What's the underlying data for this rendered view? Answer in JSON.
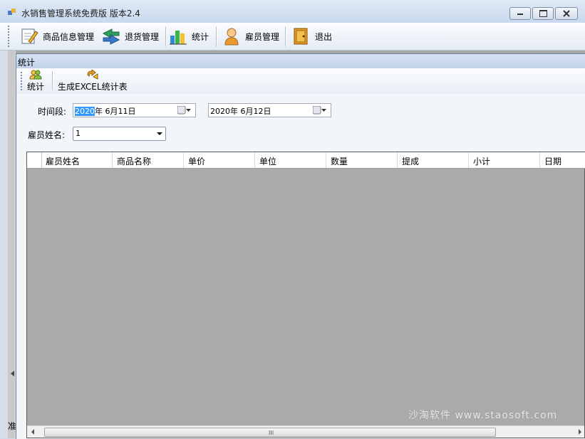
{
  "window": {
    "title": "水销售管理系统免费版 版本2.4"
  },
  "main_toolbar": {
    "items": [
      {
        "label": "商品信息管理",
        "icon": "edit-document-icon"
      },
      {
        "label": "退货管理",
        "icon": "return-arrows-icon"
      },
      {
        "label": "统计",
        "icon": "bar-chart-icon"
      },
      {
        "label": "雇员管理",
        "icon": "employee-icon"
      },
      {
        "label": "退出",
        "icon": "exit-door-icon"
      }
    ]
  },
  "status_bar": {
    "text_fragment": "准"
  },
  "child_window": {
    "title": "统计",
    "toolbar": {
      "items": [
        {
          "label": "统计",
          "icon": "users-icon"
        },
        {
          "label": "生成EXCEL统计表",
          "icon": "export-icon"
        }
      ]
    },
    "form": {
      "period_label": "时间段:",
      "start_date": {
        "selected": "2020",
        "rest": "年  6月11日"
      },
      "end_date": {
        "value": "2020年  6月12日"
      },
      "employee_label": "雇员姓名:",
      "employee_value": "1"
    },
    "grid": {
      "columns": [
        "雇员姓名",
        "商品名称",
        "单价",
        "单位",
        "数量",
        "提成",
        "小计",
        "日期"
      ],
      "rows": [],
      "scroll_grip": "III"
    }
  },
  "watermark": "沙淘软件 www.staosoft.com",
  "colors": {
    "selection": "#3399ff",
    "grid_background": "#aaaaaa",
    "mdi_background": "#a9a9a9"
  }
}
